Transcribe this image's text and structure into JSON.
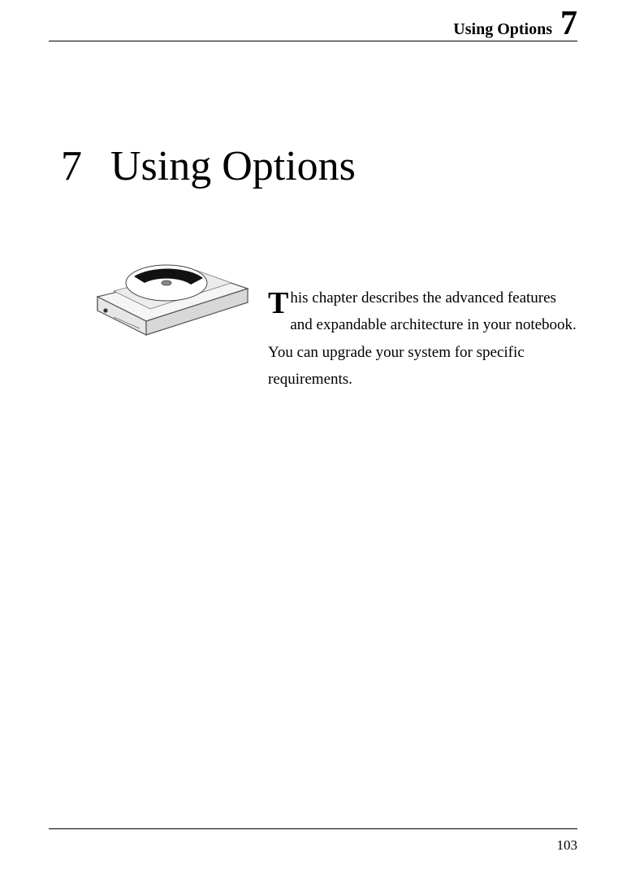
{
  "header": {
    "title": "Using Options",
    "chapter_number": "7"
  },
  "chapter": {
    "number": "7",
    "title": "Using Options"
  },
  "intro": {
    "dropcap": "T",
    "text": "his chapter describes the advanced features and expandable architecture in your notebook. You can upgrade your system for specific requirements."
  },
  "page_number": "103"
}
